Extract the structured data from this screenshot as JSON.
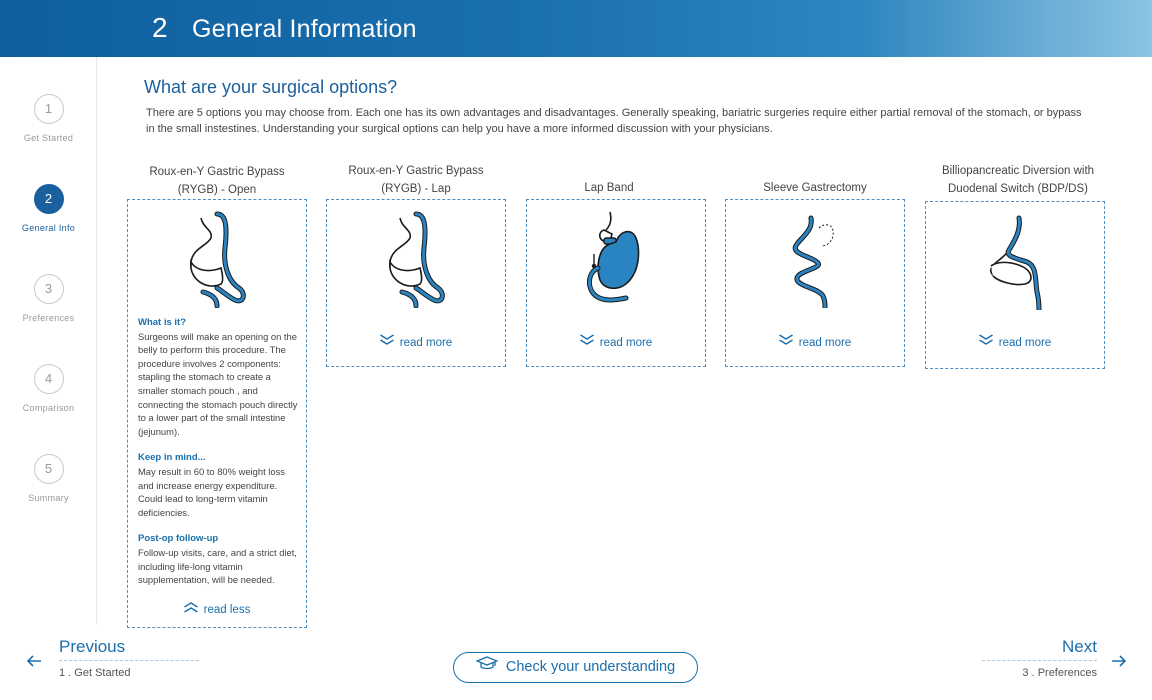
{
  "header": {
    "step_number": "2",
    "title": "General Information"
  },
  "sidebar": {
    "steps": [
      {
        "number": "1",
        "label": "Get Started"
      },
      {
        "number": "2",
        "label": "General Info"
      },
      {
        "number": "3",
        "label": "Preferences"
      },
      {
        "number": "4",
        "label": "Comparison"
      },
      {
        "number": "5",
        "label": "Summary"
      }
    ],
    "active_step": "2"
  },
  "main": {
    "title": "What are your surgical options?",
    "intro": "There are 5 options you may choose from. Each one has its own advantages and disadvantages. Generally speaking, bariatric surgeries require either partial removal of the stomach, or bypass in the small instestines. Understanding your surgical options can help you have a more informed discussion with your physicians.",
    "options": [
      {
        "title_line1": "Roux-en-Y Gastric Bypass",
        "title_line2": "(RYGB) - Open",
        "expanded": true,
        "toggle_label": "read less",
        "details": {
          "what_heading": "What is it?",
          "what_text": "Surgeons will make an opening on the belly to perform this procedure. The procedure involves 2 components: stapling the stomach to create a smaller stomach pouch , and connecting the stomach pouch directly to a lower part of the small intestine (jejunum).",
          "keep_heading": "Keep in mind...",
          "keep_text": "May result in 60 to 80% weight loss and increase energy expenditure. Could lead to long-term vitamin deficiencies.",
          "postop_heading": "Post-op follow-up",
          "postop_text": "Follow-up visits, care, and a strict diet, including life-long vitamin supplementation, will be needed."
        }
      },
      {
        "title_line1": "Roux-en-Y Gastric Bypass",
        "title_line2": "(RYGB) - Lap",
        "expanded": false,
        "toggle_label": "read more"
      },
      {
        "title_line1": "Lap Band",
        "title_line2": "",
        "expanded": false,
        "toggle_label": "read more"
      },
      {
        "title_line1": "Sleeve Gastrectomy",
        "title_line2": "",
        "expanded": false,
        "toggle_label": "read more"
      },
      {
        "title_line1": "Billiopancreatic Diversion with",
        "title_line2": "Duodenal Switch (BDP/DS)",
        "expanded": false,
        "toggle_label": "read more"
      }
    ]
  },
  "footer": {
    "previous_label": "Previous",
    "previous_sub": "1 . Get Started",
    "next_label": "Next",
    "next_sub": "3 . Preferences",
    "check_label": "Check your understanding"
  },
  "icons": {
    "prev": "arrow-left-icon",
    "next": "arrow-right-icon",
    "chev_down": "chevron-double-down-icon",
    "chev_up": "chevron-double-up-icon",
    "cap": "graduation-cap-icon"
  },
  "colors": {
    "accent": "#1a6fad",
    "active_step": "#1a5f9e",
    "header_start": "#0f5f9e",
    "header_end": "#8cc4e2"
  }
}
